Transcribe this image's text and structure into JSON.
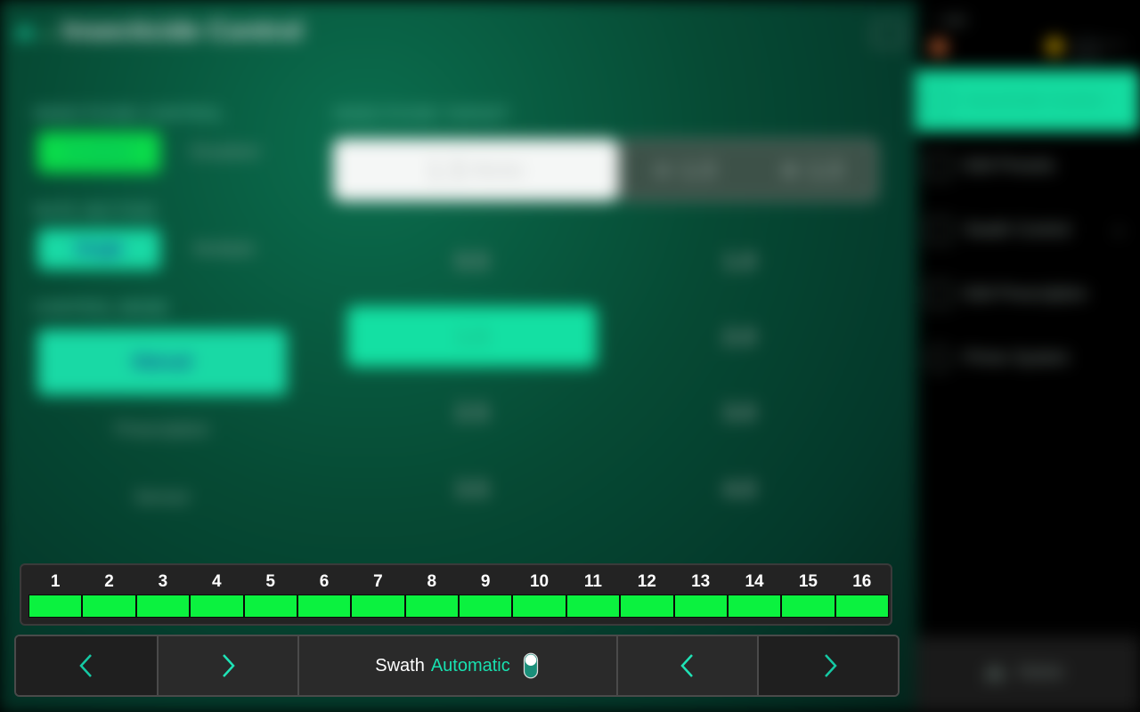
{
  "header": {
    "title": "Insecticide Control"
  },
  "status": {
    "speed_value": "--",
    "speed_unit": "mph"
  },
  "left_panel": {
    "insecticide_control": {
      "label": "INSECTICIDE CONTROL",
      "options": [
        "Enabled",
        "Disabled"
      ],
      "selected": "Enabled"
    },
    "rate_section": {
      "label": "RATE SECTION",
      "options": [
        "Single",
        "Multiple"
      ],
      "selected": "Single"
    },
    "control_mode": {
      "label": "CONTROL MODE",
      "options": [
        "Manual",
        "Prescription",
        "Sensor"
      ],
      "selected": "Manual"
    }
  },
  "target": {
    "label": "INSECTICIDE TARGET",
    "value": "1.5",
    "unit": "lbs/ac",
    "decrement": "1.0",
    "increment": "1.0",
    "presets": [
      "0.5",
      "1.0",
      "1.5",
      "2.0",
      "2.5",
      "3.0",
      "3.5",
      "4.0"
    ],
    "selected_preset": "1.5"
  },
  "side_menu": {
    "items": [
      "Insecticide Control",
      "Edit Presets",
      "Swath Control",
      "Edit Prescription",
      "Prime System"
    ],
    "active": "Insecticide Control",
    "home_label": "Home"
  },
  "swath": {
    "sections": [
      "1",
      "2",
      "3",
      "4",
      "5",
      "6",
      "7",
      "8",
      "9",
      "10",
      "11",
      "12",
      "13",
      "14",
      "15",
      "16"
    ],
    "section_color": "#0bf23f",
    "label": "Swath",
    "mode": "Automatic",
    "accent": "#18e0b0"
  }
}
